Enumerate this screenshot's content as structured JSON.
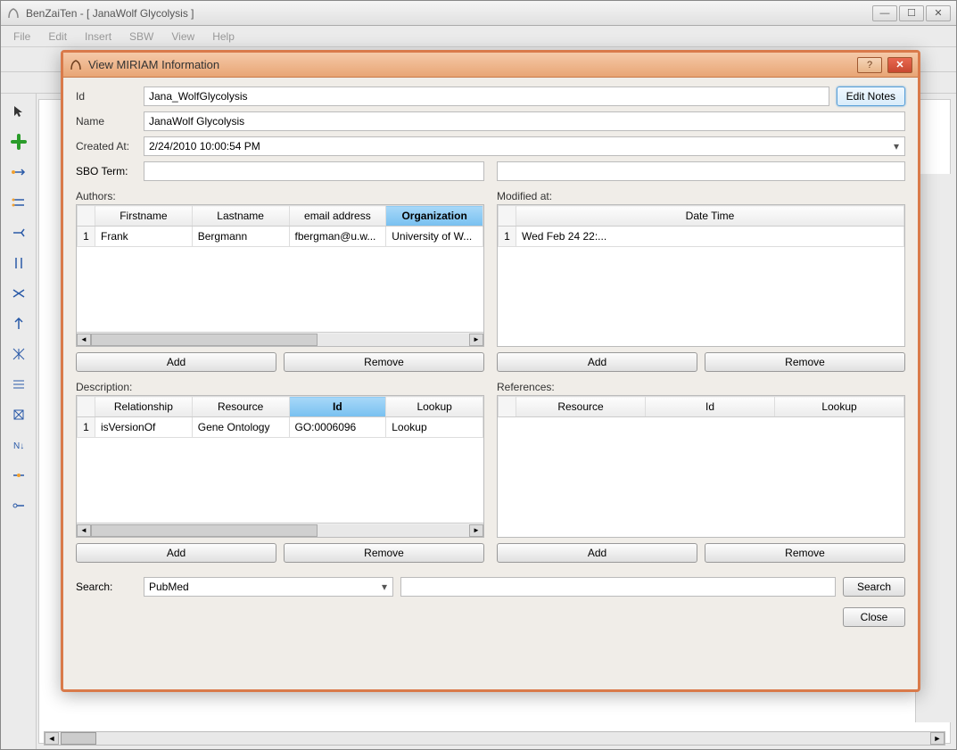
{
  "window": {
    "title": "BenZaiTen - [ JanaWolf Glycolysis ]"
  },
  "menu": {
    "file": "File",
    "edit": "Edit",
    "insert": "Insert",
    "sbw": "SBW",
    "view": "View",
    "help": "Help"
  },
  "dialog": {
    "title": "View MIRIAM Information",
    "labels": {
      "id": "Id",
      "name": "Name",
      "created": "Created At:",
      "sbo": "SBO Term:",
      "authors": "Authors:",
      "modified": "Modified at:",
      "description": "Description:",
      "references": "References:",
      "search": "Search:"
    },
    "fields": {
      "id": "Jana_WolfGlycolysis",
      "name": "JanaWolf Glycolysis",
      "created": "2/24/2010 10:00:54 PM",
      "sbo_left": "",
      "sbo_right": ""
    },
    "buttons": {
      "edit_notes": "Edit Notes",
      "add": "Add",
      "remove": "Remove",
      "search": "Search",
      "close": "Close"
    },
    "authors": {
      "headers": {
        "firstname": "Firstname",
        "lastname": "Lastname",
        "email": "email address",
        "organization": "Organization"
      },
      "rows": [
        {
          "n": "1",
          "firstname": "Frank",
          "lastname": "Bergmann",
          "email": "fbergman@u.w...",
          "organization": "University of W..."
        }
      ]
    },
    "modified": {
      "headers": {
        "datetime": "Date Time"
      },
      "rows": [
        {
          "n": "1",
          "datetime": "Wed Feb 24 22:..."
        }
      ]
    },
    "description_table": {
      "headers": {
        "relationship": "Relationship",
        "resource": "Resource",
        "id": "Id",
        "lookup": "Lookup"
      },
      "rows": [
        {
          "n": "1",
          "relationship": "isVersionOf",
          "resource": "Gene Ontology",
          "id": "GO:0006096",
          "lookup": "Lookup"
        }
      ]
    },
    "references_table": {
      "headers": {
        "resource": "Resource",
        "id": "Id",
        "lookup": "Lookup"
      },
      "rows": []
    },
    "search": {
      "source": "PubMed",
      "query": ""
    }
  }
}
